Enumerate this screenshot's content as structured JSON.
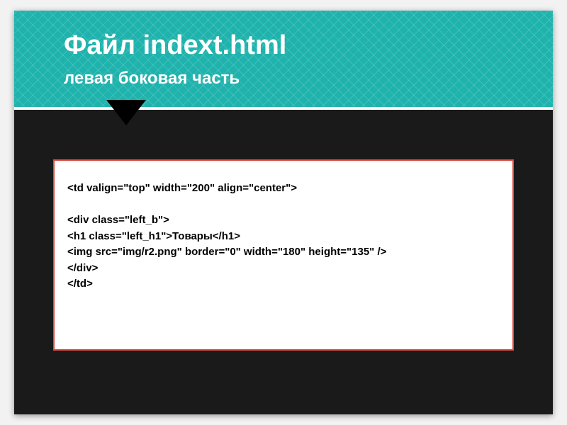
{
  "header": {
    "title": "Файл indext.html",
    "subtitle": "левая боковая часть"
  },
  "code": {
    "line1": "<td valign=\"top\" width=\"200\" align=\"center\">",
    "blank1": "",
    "line2": "<div class=\"left_b\">",
    "line3": "<h1 class=\"left_h1\">Товары</h1>",
    "line4": "<img src=\"img/r2.png\" border=\"0\" width=\"180\" height=\"135\" />",
    "line5": "</div>",
    "line6": "</td>"
  }
}
